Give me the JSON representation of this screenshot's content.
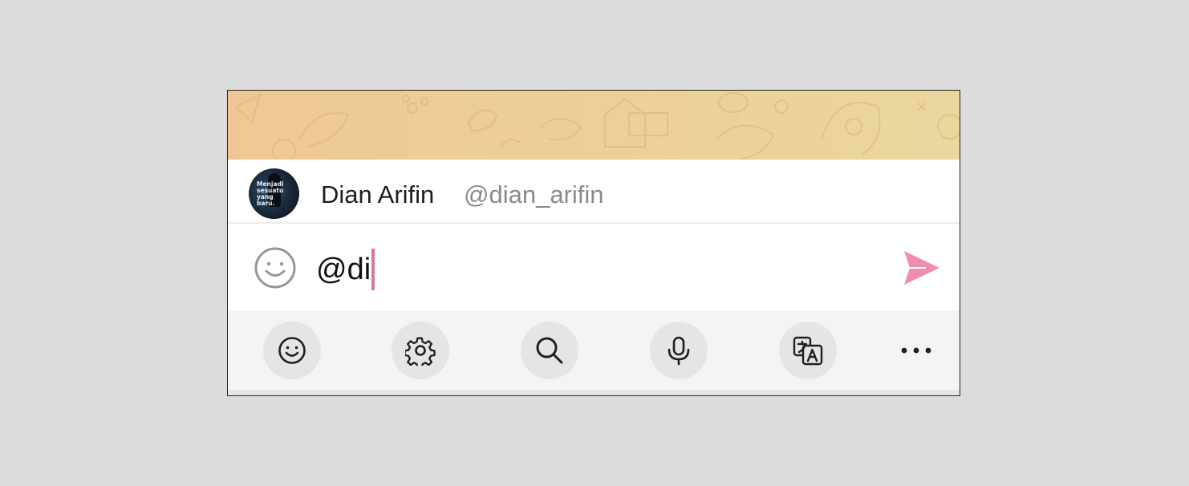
{
  "mention_suggestion": {
    "name": "Dian Arifin",
    "username": "@dian_arifin",
    "avatar_caption": "Menjadi sesuatu yang baru."
  },
  "composer": {
    "text": "@di",
    "caret_color": "#d7779e",
    "send_color": "#ef8db0",
    "emoji_icon": "smiley-icon",
    "send_icon": "send-icon"
  },
  "toolbar": {
    "items": [
      {
        "icon": "smiley-icon"
      },
      {
        "icon": "gear-icon"
      },
      {
        "icon": "search-icon"
      },
      {
        "icon": "microphone-icon"
      },
      {
        "icon": "translate-icon"
      },
      {
        "icon": "more-icon"
      }
    ]
  }
}
